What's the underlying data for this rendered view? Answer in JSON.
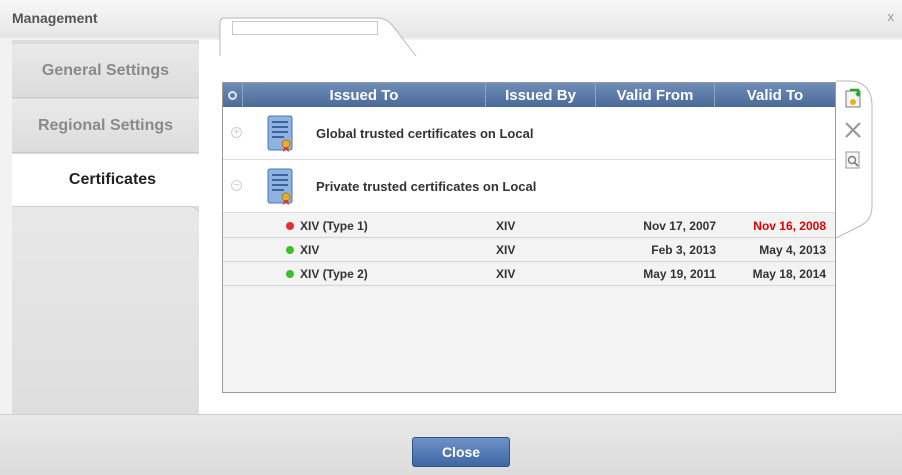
{
  "window": {
    "title": "Management",
    "close_glyph": "x"
  },
  "sidebar": {
    "items": [
      {
        "label": "General Settings"
      },
      {
        "label": "Regional Settings"
      },
      {
        "label": "Certificates"
      }
    ]
  },
  "search": {
    "value": ""
  },
  "table": {
    "columns": [
      "Issued To",
      "Issued By",
      "Valid From",
      "Valid To"
    ],
    "groups": [
      {
        "label": "Global trusted certificates on Local",
        "expander": "+"
      },
      {
        "label": "Private trusted certificates on Local",
        "expander": "−"
      }
    ],
    "rows": [
      {
        "status": "red",
        "issued_to": "XIV (Type 1)",
        "issued_by": "XIV",
        "valid_from": "Nov 17, 2007",
        "valid_to": "Nov 16, 2008",
        "expired": true
      },
      {
        "status": "green",
        "issued_to": "XIV",
        "issued_by": "XIV",
        "valid_from": "Feb 3, 2013",
        "valid_to": "May 4, 2013",
        "expired": false
      },
      {
        "status": "green",
        "issued_to": "XIV (Type 2)",
        "issued_by": "XIV",
        "valid_from": "May 19, 2011",
        "valid_to": "May 18, 2014",
        "expired": false
      }
    ]
  },
  "tools": [
    {
      "name": "import-certificate-icon"
    },
    {
      "name": "delete-icon"
    },
    {
      "name": "view-details-icon"
    }
  ],
  "colors": {
    "header_blue": "#5a78a8",
    "status_red": "#e03030",
    "status_green": "#3cbf2c",
    "expired_text": "#e00000"
  },
  "footer": {
    "close_label": "Close"
  }
}
